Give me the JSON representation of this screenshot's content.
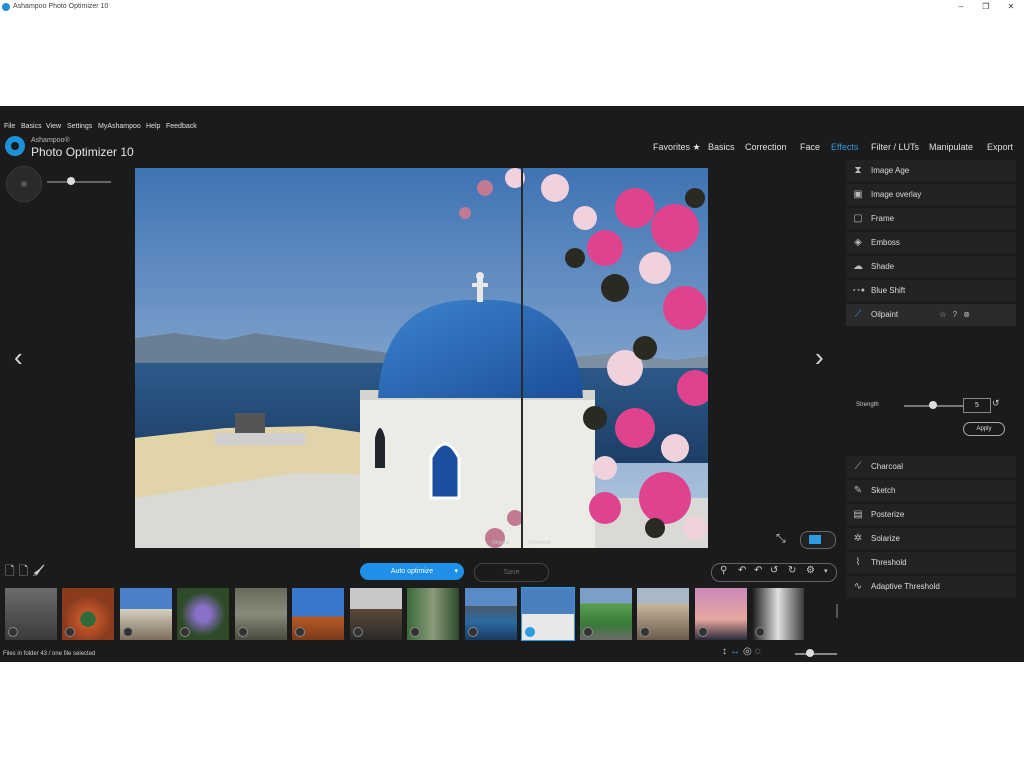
{
  "window": {
    "title": "Ashampoo Photo Optimizer 10",
    "minimize": "–",
    "maximize": "❐",
    "close": "✕"
  },
  "menu": [
    "File",
    "Basics",
    "View",
    "Settings",
    "MyAshampoo",
    "Help",
    "Feedback"
  ],
  "brand": {
    "small": "Ashampoo®",
    "name": "Photo Optimizer 10"
  },
  "tabs": [
    {
      "label": "Favorites ★"
    },
    {
      "label": "Basics"
    },
    {
      "label": "Correction"
    },
    {
      "label": "Face"
    },
    {
      "label": "Effects"
    },
    {
      "label": "Filter / LUTs"
    },
    {
      "label": "Manipulate"
    },
    {
      "label": "Export"
    }
  ],
  "active_tab": "Effects",
  "photo": {
    "credit": "© Katharina Stang",
    "original_label": "Original",
    "optimized_label": "Optimized"
  },
  "nav": {
    "prev": "‹",
    "next": "›"
  },
  "effects": [
    {
      "label": "Image Age",
      "icon": "hourglass-icon"
    },
    {
      "label": "Image overlay",
      "icon": "overlay-icon"
    },
    {
      "label": "Frame",
      "icon": "frame-icon"
    },
    {
      "label": "Emboss",
      "icon": "emboss-icon"
    },
    {
      "label": "Shade",
      "icon": "shade-icon"
    },
    {
      "label": "Blue Shift",
      "icon": "blue-shift-icon"
    },
    {
      "label": "Oilpaint",
      "icon": "brush-icon",
      "selected": true
    },
    {
      "label": "Charcoal",
      "icon": "charcoal-icon"
    },
    {
      "label": "Sketch",
      "icon": "pencil-icon"
    },
    {
      "label": "Posterize",
      "icon": "posterize-icon"
    },
    {
      "label": "Solarize",
      "icon": "solarize-icon"
    },
    {
      "label": "Threshold",
      "icon": "threshold-icon"
    },
    {
      "label": "Adaptive Threshold",
      "icon": "adaptive-threshold-icon"
    }
  ],
  "oilpaint": {
    "tools": "☆ ? ⊗",
    "strength_label": "Strength",
    "strength_value": "5",
    "apply": "Apply"
  },
  "actions": {
    "auto_optimize": "Auto optimize",
    "dropdown": "▾",
    "save": "Save"
  },
  "status": {
    "text": "Files in folder 43 / one file selected"
  },
  "colors": {
    "accent": "#2f9be0",
    "background": "#1b1b1b",
    "panel": "#222222"
  }
}
